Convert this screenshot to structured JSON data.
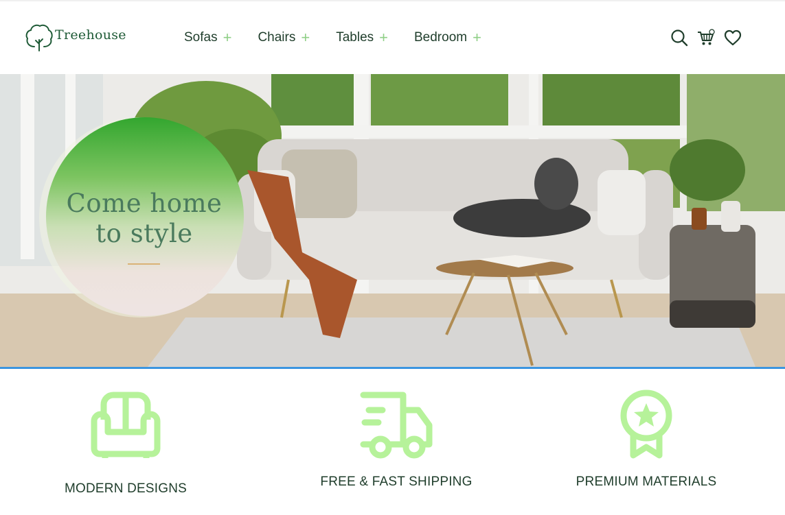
{
  "brand": {
    "name": "Treehouse",
    "icon": "tree-logo-icon"
  },
  "nav": {
    "items": [
      {
        "label": "Sofas",
        "expand_icon": "+"
      },
      {
        "label": "Chairs",
        "expand_icon": "+"
      },
      {
        "label": "Tables",
        "expand_icon": "+"
      },
      {
        "label": "Bedroom",
        "expand_icon": "+"
      }
    ]
  },
  "header_icons": [
    "search-icon",
    "cart-icon",
    "heart-icon"
  ],
  "hero": {
    "title_line1": "Come home",
    "title_line2": "to style"
  },
  "features": [
    {
      "label": "MODERN DESIGNS",
      "icon": "armchair-icon"
    },
    {
      "label": "FREE & FAST SHIPPING",
      "icon": "truck-icon"
    },
    {
      "label": "PREMIUM MATERIALS",
      "icon": "award-ribbon-icon"
    }
  ],
  "colors": {
    "brand_green": "#1e5a36",
    "accent_light_green": "#b6f29a",
    "plus_green": "#8fcf86",
    "text_dark": "#1f3d2b",
    "hero_divider": "#3b95e0"
  }
}
